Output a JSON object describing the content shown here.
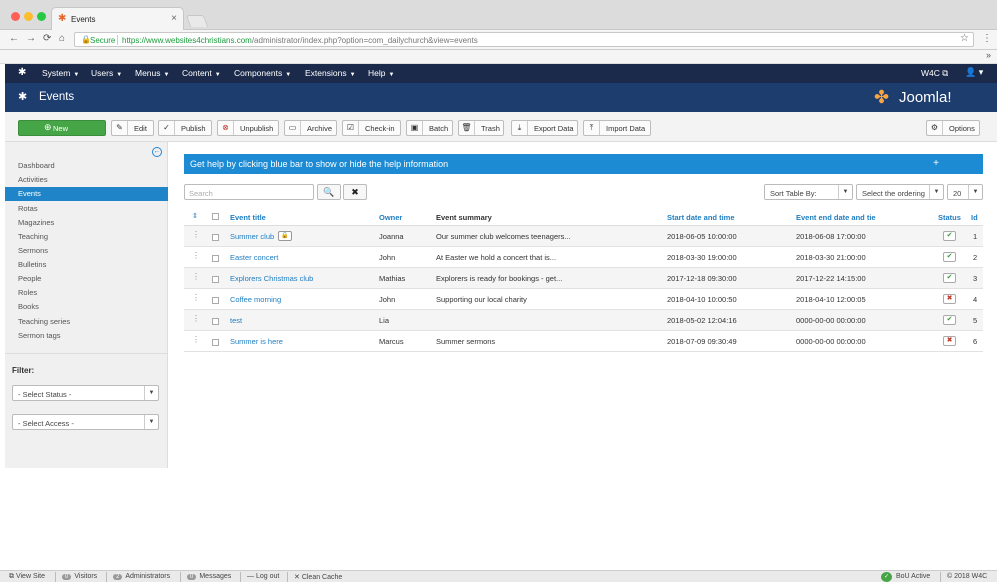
{
  "browser": {
    "tab_title": "Events",
    "tab_close": "×",
    "secure_label": "Secure",
    "url_domain": "https://www.websites4christians.com",
    "url_path": "/administrator/index.php?option=com_dailychurch&view=events",
    "back_glyph": "←",
    "forward_glyph": "→",
    "reload_glyph": "⟳",
    "home_glyph": "⌂",
    "star_glyph": "☆",
    "menu_glyph": "⋮",
    "extensions_glyph": "»"
  },
  "topnav": {
    "items": [
      "System",
      "Users",
      "Menus",
      "Content",
      "Components",
      "Extensions",
      "Help"
    ],
    "site_link": "W4C ⧉",
    "user_glyph": "👤 ▾"
  },
  "page": {
    "title": "Events",
    "brand_word": "Joomla!"
  },
  "toolbar": {
    "new": "New",
    "edit": "Edit",
    "publish": "Publish",
    "unpublish": "Unpublish",
    "archive": "Archive",
    "checkin": "Check-in",
    "batch": "Batch",
    "trash": "Trash",
    "export": "Export Data",
    "import": "Import Data",
    "options": "Options"
  },
  "sidebar": {
    "items": [
      "Dashboard",
      "Activities",
      "Events",
      "Rotas",
      "Magazines",
      "Teaching",
      "Sermons",
      "Bulletins",
      "People",
      "Roles",
      "Books",
      "Teaching series",
      "Sermon tags"
    ],
    "active_index": 2,
    "filter_label": "Filter:",
    "status_select": "- Select Status -",
    "access_select": "- Select Access -"
  },
  "help": {
    "text": "Get help by clicking blue bar to show or hide the help information",
    "plus": "+"
  },
  "search": {
    "placeholder": "Search",
    "search_glyph": "🔍",
    "clear_glyph": "✖"
  },
  "sorting": {
    "sort_by": "Sort Table By:",
    "ordering": "Select the ordering",
    "limit": "20"
  },
  "table": {
    "headers": {
      "title": "Event title",
      "owner": "Owner",
      "summary": "Event summary",
      "start": "Start date and time",
      "end": "Event end date and tie",
      "status": "Status",
      "id": "Id"
    },
    "rows": [
      {
        "title": "Summer club",
        "locked": true,
        "owner": "Joanna",
        "summary": "Our summer club welcomes teenagers...",
        "start": "2018-06-05 10:00:00",
        "end": "2018-06-08 17:00:00",
        "published": true,
        "id": "1"
      },
      {
        "title": "Easter concert",
        "locked": false,
        "owner": "John",
        "summary": "At Easter we hold a concert that is...",
        "start": "2018-03-30 19:00:00",
        "end": "2018-03-30 21:00:00",
        "published": true,
        "id": "2"
      },
      {
        "title": "Explorers Christmas club",
        "locked": false,
        "owner": "Mathias",
        "summary": "Explorers is ready for bookings - get...",
        "start": "2017-12-18 09:30:00",
        "end": "2017-12-22 14:15:00",
        "published": true,
        "id": "3"
      },
      {
        "title": "Coffee morning",
        "locked": false,
        "owner": "John",
        "summary": "Supporting our local charity",
        "start": "2018-04-10 10:00:50",
        "end": "2018-04-10 12:00:05",
        "published": false,
        "id": "4"
      },
      {
        "title": "test",
        "locked": false,
        "owner": "Lia",
        "summary": "",
        "start": "2018-05-02 12:04:16",
        "end": "0000-00-00 00:00:00",
        "published": true,
        "id": "5"
      },
      {
        "title": "Summer is here",
        "locked": false,
        "owner": "Marcus",
        "summary": "Summer sermons",
        "start": "2018-07-09 09:30:49",
        "end": "0000-00-00 00:00:00",
        "published": false,
        "id": "6"
      }
    ]
  },
  "footer": {
    "view_site": "View Site",
    "visitors_count": "0",
    "visitors": "Visitors",
    "admins_count": "2",
    "admins": "Administrators",
    "messages_count": "0",
    "messages": "Messages",
    "logout": "Log out",
    "clean_cache": "Clean Cache",
    "bou_active": "BoU Active",
    "copyright": "© 2018 W4C"
  },
  "colors": {
    "topnav": "#1b2a4a",
    "subhead": "#1c3d6e",
    "accent": "#1f85c8",
    "new_button": "#46a546"
  }
}
